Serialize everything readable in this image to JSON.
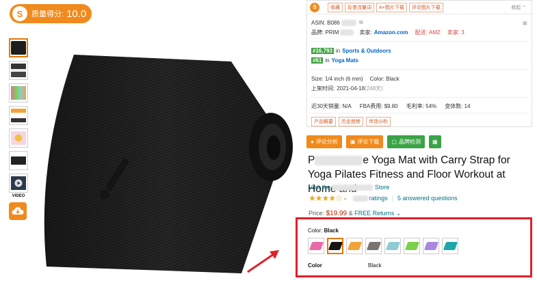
{
  "quality": {
    "logo": "S",
    "label": "质量得分:",
    "score": "10.0"
  },
  "thumbnails": {
    "video_label": "VIDEO"
  },
  "panel": {
    "logo": "S",
    "buttons": [
      "收藏",
      "反查流量词",
      "A+图片下载",
      "评论图片下载"
    ],
    "collapse": "收起 ⌃",
    "asin_label": "ASIN: B086",
    "brand_label": "品牌: PRIM",
    "seller_label": "卖家:",
    "seller_value": "Amazon.com",
    "delivery": "配送: AMZ",
    "sellers_count": "卖家: 3",
    "rank1_value": "#16,793",
    "rank1_in": "in",
    "rank1_cat": "Sports & Outdoors",
    "rank2_value": "#61",
    "rank2_in": "in",
    "rank2_cat": "Yoga Mats",
    "size": "Size: 1/4 inch (6 mm)",
    "color": "Color: Black",
    "listed_label": "上架时间:",
    "listed_value": "2021-04-18",
    "listed_days": "(248天)",
    "sales": "近30天销量: N/A",
    "fba": "FBA费用: $9.80",
    "margin": "毛利率: 54%",
    "variants": "变体数: 14",
    "bottom_buttons": [
      "产品概要",
      "历史趋势",
      "市场分析"
    ]
  },
  "actions": [
    {
      "label": "评论分析",
      "icon": "chat-icon"
    },
    {
      "label": "评论下载",
      "icon": "download-icon"
    },
    {
      "label": "品牌检测",
      "icon": "check-icon"
    },
    {
      "label": "",
      "icon": "calculator-icon"
    }
  ],
  "product": {
    "title_start": "P",
    "title_rest": "e Yoga Mat with Carry Strap for Yoga Pilates Fitness and Floor Workout at Home and",
    "store_prefix": "Visit the",
    "store_suffix": "Store",
    "ratings_suffix": "ratings",
    "questions": "5 answered questions",
    "price_label": "Price:",
    "price": "$19.99",
    "price_amp": "&",
    "returns": "FREE Returns ⌄"
  },
  "color_selector": {
    "label": "Color:",
    "selected": "Black",
    "swatch_colors": [
      "#e86aaa",
      "#151515",
      "#f1a33a",
      "#7a7370",
      "#8fcbd4",
      "#7ad04a",
      "#a989e0",
      "#1fa7a8"
    ],
    "footer_left": "Color",
    "footer_right": "Black"
  }
}
